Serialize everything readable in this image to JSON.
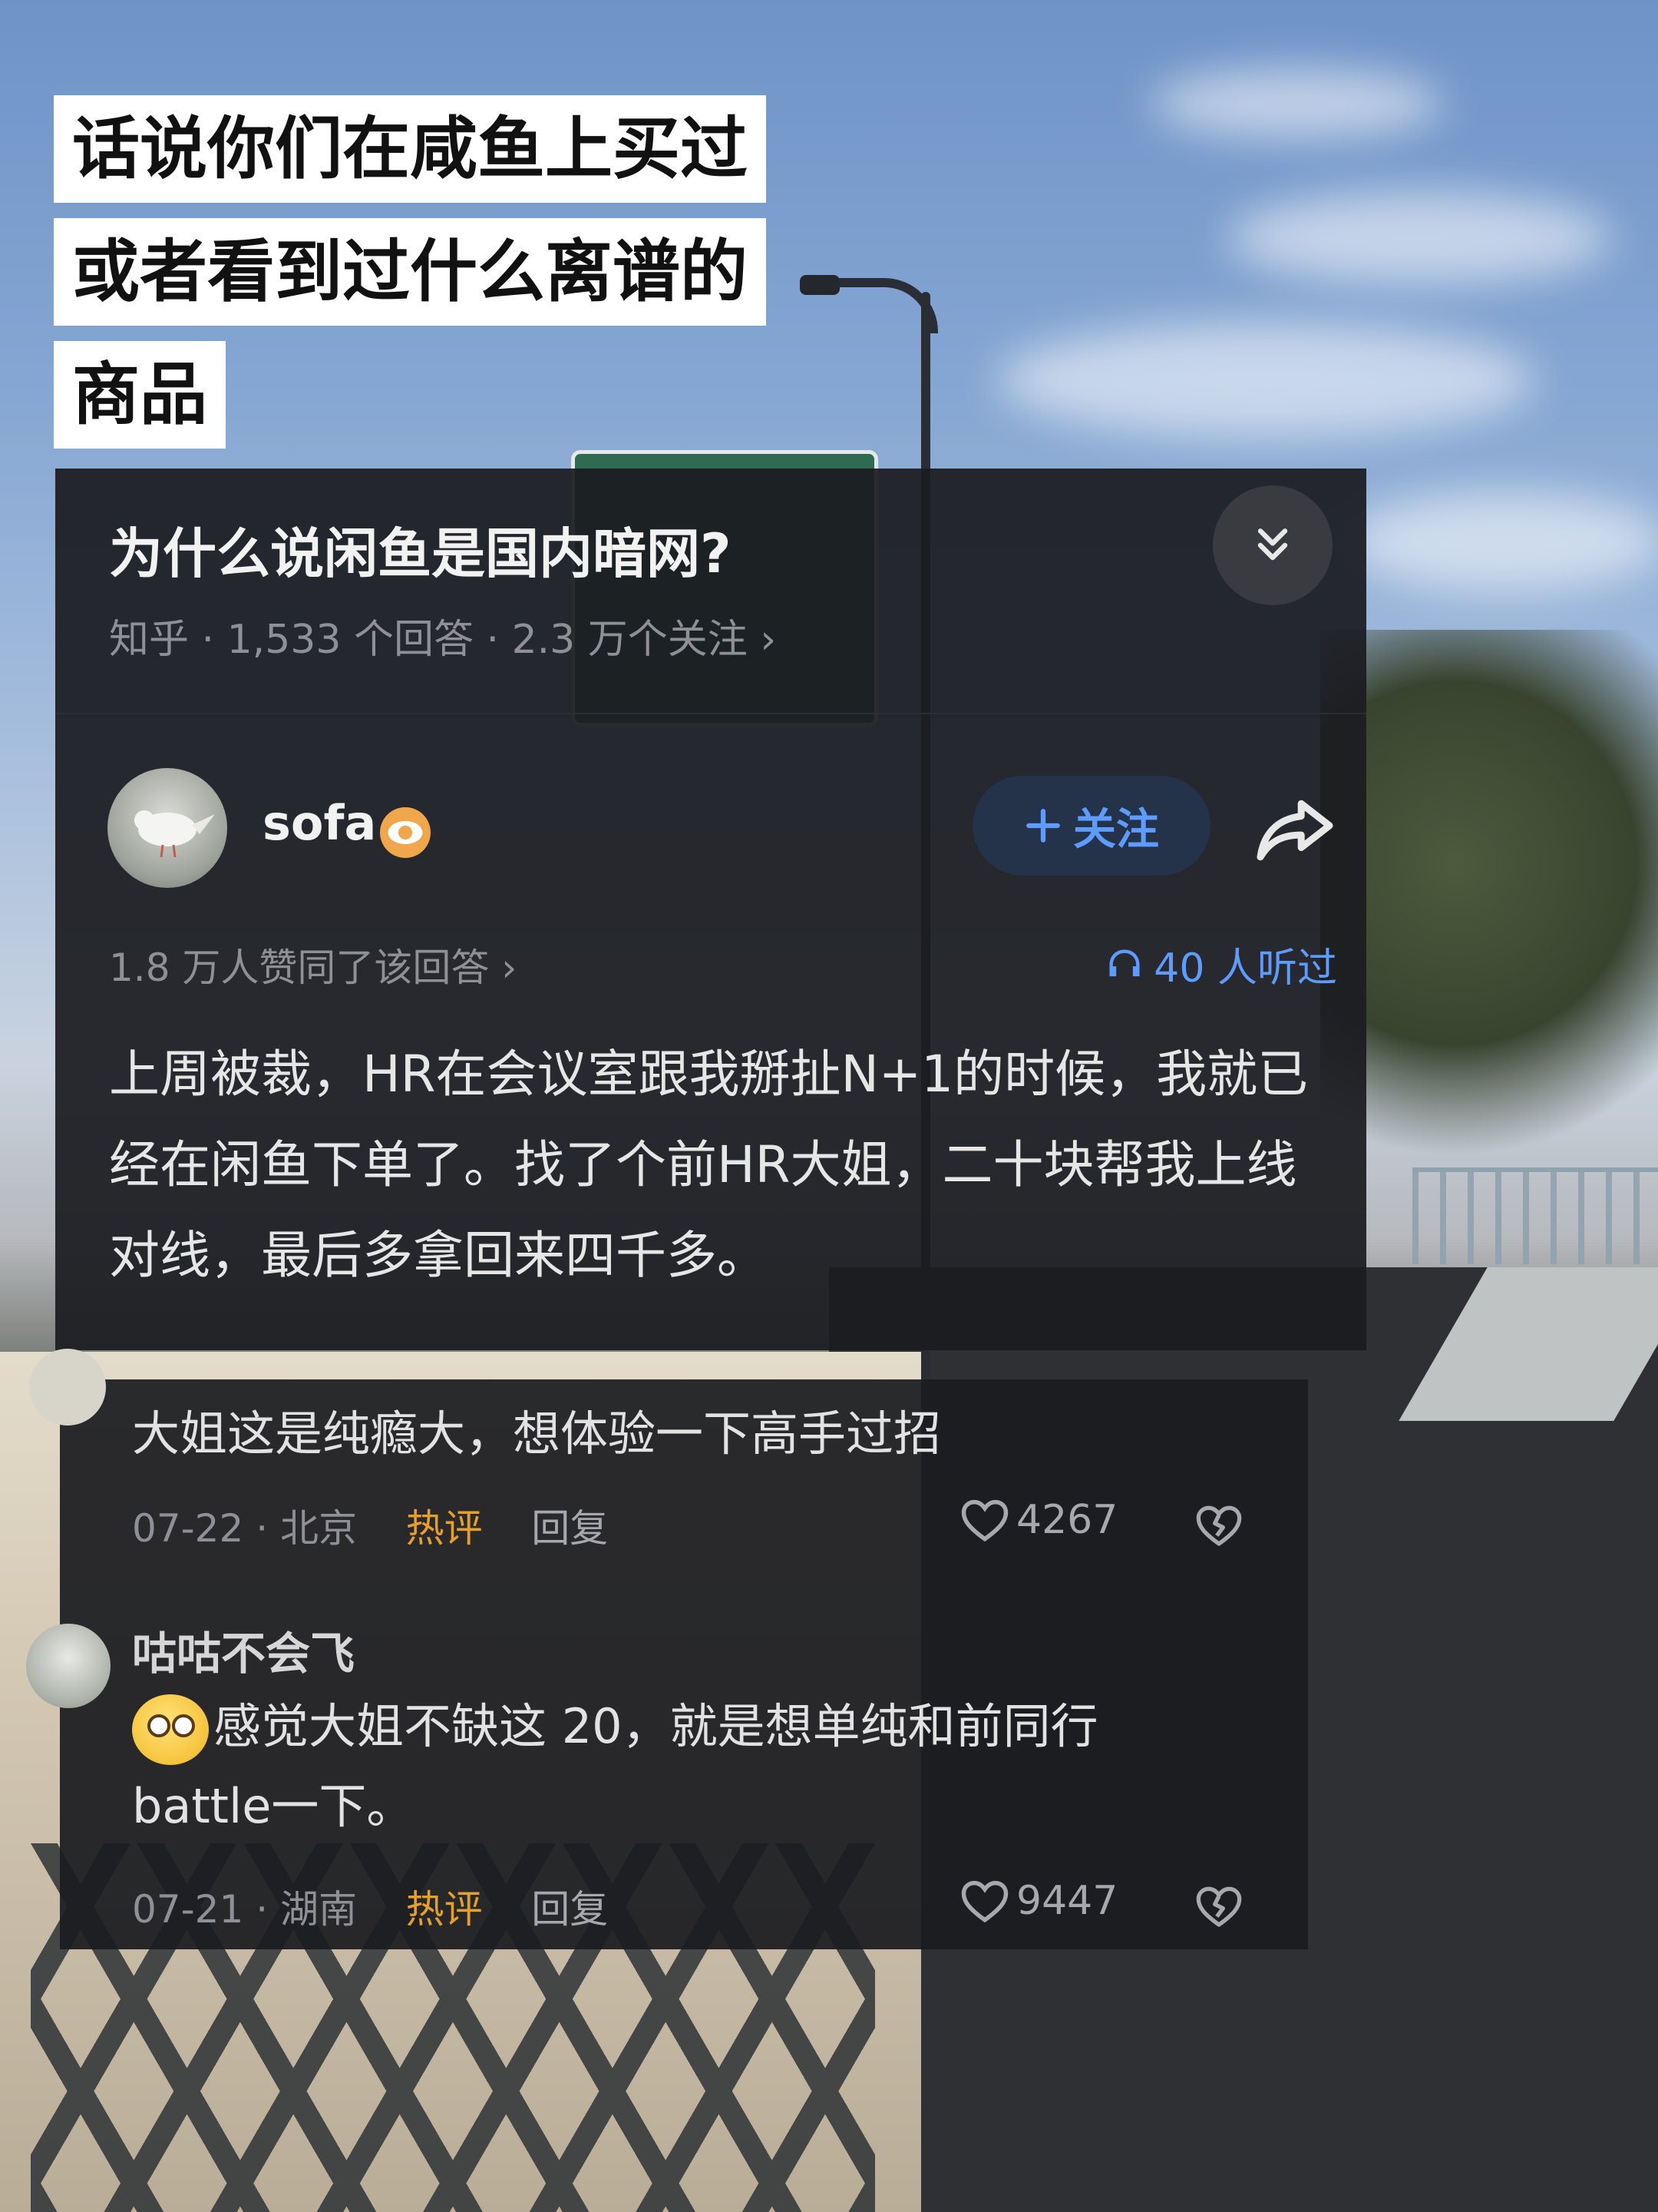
{
  "title_lines": [
    "话说你们在咸鱼上买过",
    "或者看到过什么离谱的",
    "商品"
  ],
  "question": {
    "title": "为什么说闲鱼是国内暗网?",
    "meta": "知乎 · 1,533 个回答 · 2.3 万个关注 ›"
  },
  "answer": {
    "author": "sofa",
    "follow_label": "关注",
    "votes": "1.8 万人赞同了该回答 ›",
    "listen_count": "40 人听过",
    "content": "上周被裁，HR在会议室跟我掰扯N+1的时候，我就已经在闲鱼下单了。找了个前HR大姐，二十块帮我上线对线，最后多拿回来四千多。"
  },
  "comments": [
    {
      "text": "大姐这是纯瘾大，想体验一下高手过招",
      "date": "07-22",
      "location": "北京",
      "hot_label": "热评",
      "reply_label": "回复",
      "likes": "4267"
    },
    {
      "user": "咕咕不会飞",
      "text": "感觉大姐不缺这 20，就是想单纯和前同行battle一下。",
      "date": "07-21",
      "location": "湖南",
      "hot_label": "热评",
      "reply_label": "回复",
      "likes": "9447"
    }
  ],
  "icons": {
    "collapse": "chevrons-down-icon",
    "badge": "eye-badge-icon",
    "follow": "plus-icon",
    "share": "share-arrow-icon",
    "headphones": "headphones-icon",
    "like": "heart-icon",
    "dislike": "broken-heart-icon",
    "emoji": "dizzy-eyes-emoji-icon"
  },
  "colors": {
    "accent_blue": "#5d9bff",
    "hot_orange": "#e5a029",
    "badge_orange": "#f0a64a",
    "card_bg": "#1b1c20"
  }
}
